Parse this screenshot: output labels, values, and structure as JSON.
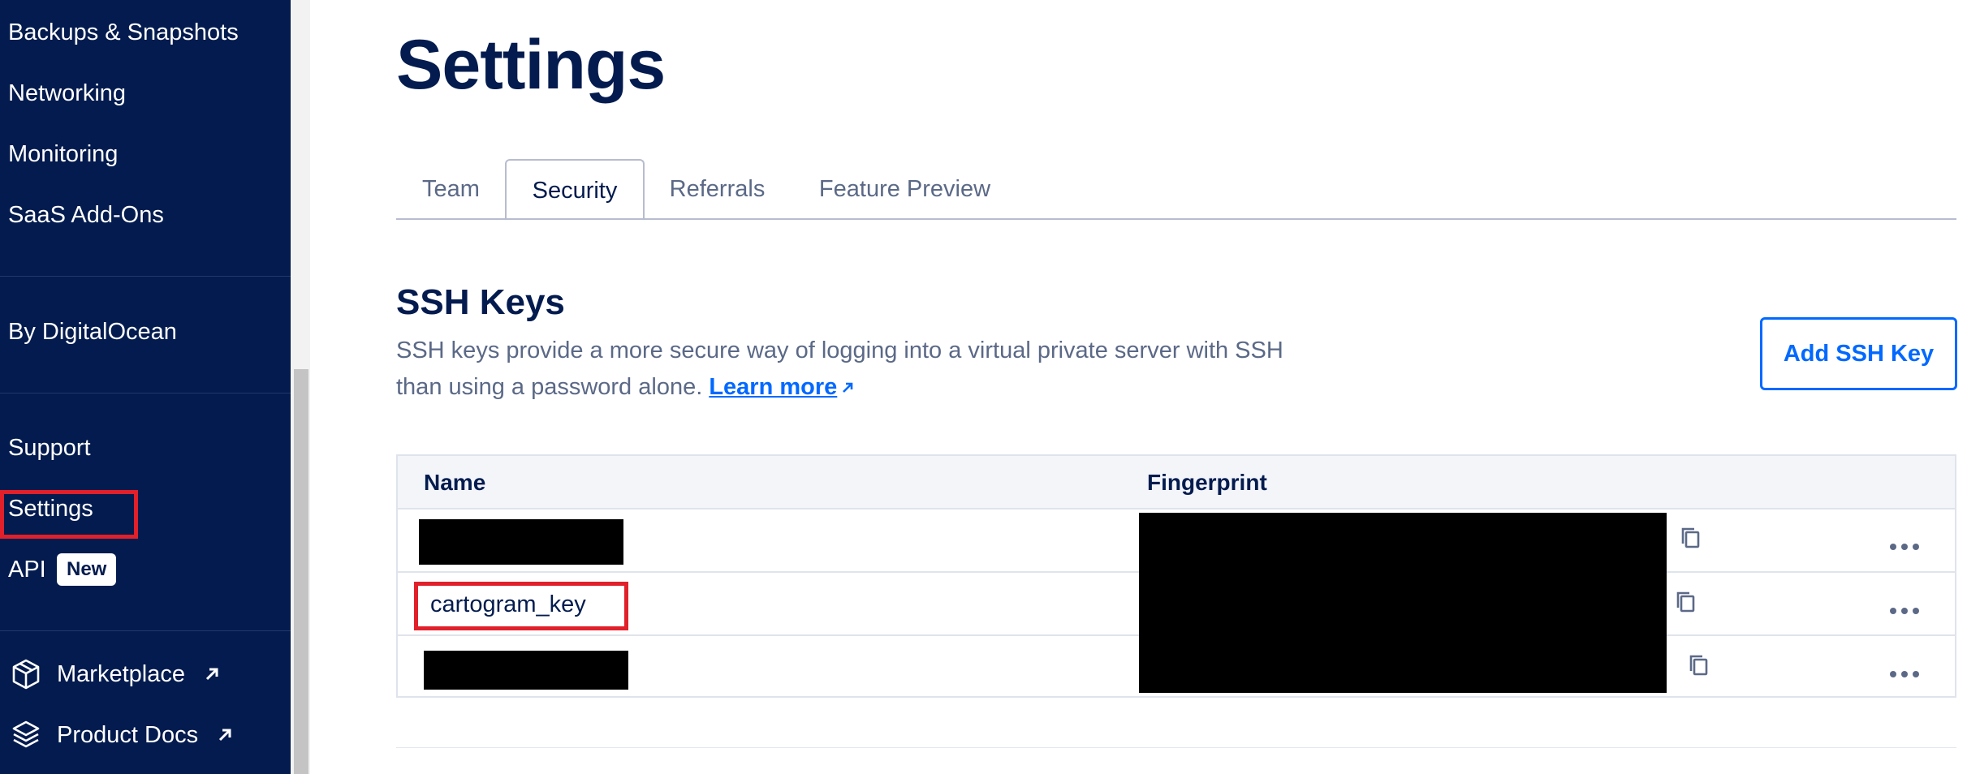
{
  "sidebar": {
    "items": [
      {
        "label": "Backups & Snapshots"
      },
      {
        "label": "Networking"
      },
      {
        "label": "Monitoring"
      },
      {
        "label": "SaaS Add-Ons"
      },
      {
        "label": "By DigitalOcean"
      },
      {
        "label": "Support"
      },
      {
        "label": "Settings"
      },
      {
        "label": "API",
        "badge": "New"
      },
      {
        "label": "Marketplace",
        "icon": "cube-icon",
        "external": true
      },
      {
        "label": "Product Docs",
        "icon": "layers-icon",
        "external": true
      }
    ]
  },
  "page": {
    "title": "Settings"
  },
  "tabs": [
    {
      "label": "Team",
      "active": false
    },
    {
      "label": "Security",
      "active": true
    },
    {
      "label": "Referrals",
      "active": false
    },
    {
      "label": "Feature Preview",
      "active": false
    }
  ],
  "ssh": {
    "title": "SSH Keys",
    "description": "SSH keys provide a more secure way of logging into a virtual private server with SSH than using a password alone.",
    "learn_more": "Learn more",
    "add_button": "Add SSH Key",
    "columns": [
      "Name",
      "Fingerprint"
    ],
    "rows": [
      {
        "name": "",
        "redacted": true
      },
      {
        "name": "cartogram_key",
        "redacted": false
      },
      {
        "name": "",
        "redacted": true
      }
    ]
  },
  "colors": {
    "sidebar_bg": "#031b4e",
    "accent": "#0069ff",
    "highlight": "#e0202a",
    "muted_text": "#5b6987"
  }
}
